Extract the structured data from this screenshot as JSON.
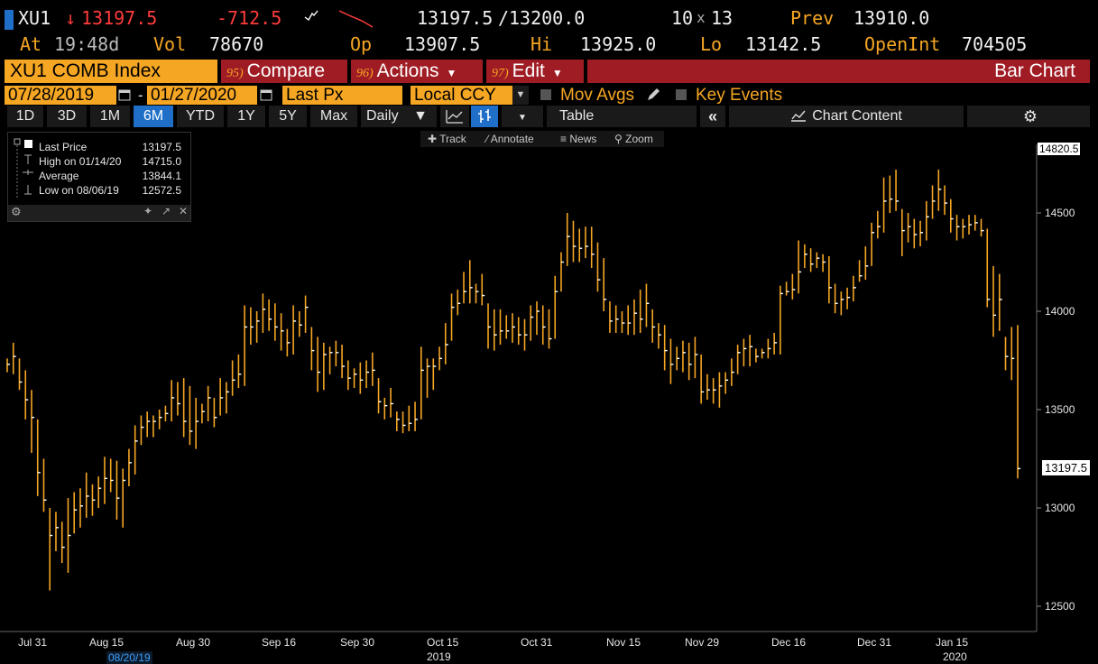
{
  "header": {
    "ticker": "XU1",
    "last": "13197.5",
    "change": "-712.5",
    "bid_ask": "13197.5",
    "ask": "13200.0",
    "size1": "10",
    "size2": "13",
    "prev_label": "Prev",
    "prev": "13910.0",
    "at_label": "At",
    "time": "19:48d",
    "vol_label": "Vol",
    "vol": "78670",
    "op_label": "Op",
    "op": "13907.5",
    "hi_label": "Hi",
    "hi": "13925.0",
    "lo_label": "Lo",
    "lo": "13142.5",
    "oi_label": "OpenInt",
    "oi": "704505"
  },
  "menu": {
    "security": "XU1 COMB Index",
    "compare_num": "95)",
    "compare": "Compare",
    "actions_num": "96)",
    "actions": "Actions",
    "edit_num": "97)",
    "edit": "Edit",
    "view": "Bar Chart"
  },
  "controls": {
    "start_date": "07/28/2019",
    "end_date": "01/27/2020",
    "field": "Last Px",
    "currency": "Local CCY",
    "mov_avgs": "Mov Avgs",
    "key_events": "Key Events"
  },
  "toolbar": {
    "periods": [
      "1D",
      "3D",
      "1M",
      "6M",
      "YTD",
      "1Y",
      "5Y",
      "Max"
    ],
    "selected_period": "6M",
    "frequency": "Daily",
    "table": "Table",
    "chart_content": "Chart Content"
  },
  "tools": {
    "track": "Track",
    "annotate": "Annotate",
    "news": "News",
    "zoom": "Zoom"
  },
  "legend": {
    "last_label": "Last Price",
    "last_value": "13197.5",
    "high_label": "High on 01/14/20",
    "high_value": "14715.0",
    "avg_label": "Average",
    "avg_value": "13844.1",
    "low_label": "Low on 08/06/19",
    "low_value": "12572.5"
  },
  "chart_data": {
    "type": "bar",
    "ylim": [
      12400,
      14900
    ],
    "y_ticks": [
      12500,
      13000,
      13500,
      14000,
      14500
    ],
    "y_tick_labels": [
      "12500",
      "13000",
      "13500",
      "14000",
      "14500"
    ],
    "top_marker": "14820.5",
    "last_marker": "13197.5",
    "x_tick_labels": [
      "Jul 31",
      "Aug 15",
      "Aug 30",
      "Sep 16",
      "Sep 30",
      "Oct 15",
      "Oct 31",
      "Nov 15",
      "Nov 29",
      "Dec 16",
      "Dec 31",
      "Jan 15"
    ],
    "x_sub_labels": [
      "08/20/19",
      "2019",
      "2020"
    ],
    "bars": [
      {
        "h": 13760,
        "l": 13690,
        "c": 13730
      },
      {
        "h": 13840,
        "l": 13680,
        "c": 13770
      },
      {
        "h": 13760,
        "l": 13600,
        "c": 13640
      },
      {
        "h": 13700,
        "l": 13450,
        "c": 13550
      },
      {
        "h": 13600,
        "l": 13280,
        "c": 13460
      },
      {
        "h": 13450,
        "l": 13060,
        "c": 13180
      },
      {
        "h": 13250,
        "l": 12980,
        "c": 13040
      },
      {
        "h": 13000,
        "l": 12580,
        "c": 12860
      },
      {
        "h": 12980,
        "l": 12780,
        "c": 12900
      },
      {
        "h": 12930,
        "l": 12720,
        "c": 12800
      },
      {
        "h": 13050,
        "l": 12670,
        "c": 12860
      },
      {
        "h": 13080,
        "l": 12870,
        "c": 12990
      },
      {
        "h": 13100,
        "l": 12900,
        "c": 13010
      },
      {
        "h": 13180,
        "l": 12950,
        "c": 13060
      },
      {
        "h": 13120,
        "l": 12960,
        "c": 13040
      },
      {
        "h": 13160,
        "l": 13000,
        "c": 13100
      },
      {
        "h": 13260,
        "l": 13020,
        "c": 13150
      },
      {
        "h": 13250,
        "l": 13080,
        "c": 13140
      },
      {
        "h": 13240,
        "l": 12940,
        "c": 13050
      },
      {
        "h": 13200,
        "l": 12900,
        "c": 13140
      },
      {
        "h": 13300,
        "l": 13110,
        "c": 13230
      },
      {
        "h": 13420,
        "l": 13170,
        "c": 13340
      },
      {
        "h": 13470,
        "l": 13320,
        "c": 13410
      },
      {
        "h": 13490,
        "l": 13360,
        "c": 13440
      },
      {
        "h": 13470,
        "l": 13360,
        "c": 13440
      },
      {
        "h": 13500,
        "l": 13400,
        "c": 13460
      },
      {
        "h": 13520,
        "l": 13440,
        "c": 13480
      },
      {
        "h": 13650,
        "l": 13440,
        "c": 13560
      },
      {
        "h": 13640,
        "l": 13470,
        "c": 13530
      },
      {
        "h": 13660,
        "l": 13360,
        "c": 13440
      },
      {
        "h": 13620,
        "l": 13320,
        "c": 13390
      },
      {
        "h": 13560,
        "l": 13300,
        "c": 13440
      },
      {
        "h": 13530,
        "l": 13430,
        "c": 13490
      },
      {
        "h": 13620,
        "l": 13440,
        "c": 13560
      },
      {
        "h": 13560,
        "l": 13410,
        "c": 13460
      },
      {
        "h": 13660,
        "l": 13470,
        "c": 13560
      },
      {
        "h": 13640,
        "l": 13480,
        "c": 13590
      },
      {
        "h": 13750,
        "l": 13570,
        "c": 13650
      },
      {
        "h": 13780,
        "l": 13610,
        "c": 13680
      },
      {
        "h": 14030,
        "l": 13620,
        "c": 13920
      },
      {
        "h": 14020,
        "l": 13830,
        "c": 13920
      },
      {
        "h": 14000,
        "l": 13840,
        "c": 13950
      },
      {
        "h": 14090,
        "l": 13890,
        "c": 14010
      },
      {
        "h": 14060,
        "l": 13900,
        "c": 13960
      },
      {
        "h": 14040,
        "l": 13850,
        "c": 13920
      },
      {
        "h": 13990,
        "l": 13800,
        "c": 13900
      },
      {
        "h": 13910,
        "l": 13770,
        "c": 13840
      },
      {
        "h": 14030,
        "l": 13780,
        "c": 13950
      },
      {
        "h": 14000,
        "l": 13870,
        "c": 13930
      },
      {
        "h": 14080,
        "l": 13890,
        "c": 14020
      },
      {
        "h": 13920,
        "l": 13700,
        "c": 13800
      },
      {
        "h": 13870,
        "l": 13590,
        "c": 13690
      },
      {
        "h": 13840,
        "l": 13600,
        "c": 13780
      },
      {
        "h": 13820,
        "l": 13680,
        "c": 13790
      },
      {
        "h": 13850,
        "l": 13720,
        "c": 13790
      },
      {
        "h": 13830,
        "l": 13660,
        "c": 13720
      },
      {
        "h": 13750,
        "l": 13600,
        "c": 13660
      },
      {
        "h": 13710,
        "l": 13610,
        "c": 13680
      },
      {
        "h": 13740,
        "l": 13580,
        "c": 13650
      },
      {
        "h": 13750,
        "l": 13610,
        "c": 13690
      },
      {
        "h": 13790,
        "l": 13620,
        "c": 13700
      },
      {
        "h": 13660,
        "l": 13480,
        "c": 13540
      },
      {
        "h": 13560,
        "l": 13450,
        "c": 13520
      },
      {
        "h": 13610,
        "l": 13460,
        "c": 13530
      },
      {
        "h": 13490,
        "l": 13390,
        "c": 13450
      },
      {
        "h": 13490,
        "l": 13380,
        "c": 13420
      },
      {
        "h": 13520,
        "l": 13390,
        "c": 13430
      },
      {
        "h": 13540,
        "l": 13390,
        "c": 13450
      },
      {
        "h": 13820,
        "l": 13450,
        "c": 13700
      },
      {
        "h": 13760,
        "l": 13560,
        "c": 13720
      },
      {
        "h": 13760,
        "l": 13600,
        "c": 13720
      },
      {
        "h": 13820,
        "l": 13700,
        "c": 13760
      },
      {
        "h": 13940,
        "l": 13730,
        "c": 13830
      },
      {
        "h": 14090,
        "l": 13850,
        "c": 14020
      },
      {
        "h": 14110,
        "l": 13980,
        "c": 14040
      },
      {
        "h": 14200,
        "l": 14040,
        "c": 14100
      },
      {
        "h": 14260,
        "l": 14040,
        "c": 14120
      },
      {
        "h": 14140,
        "l": 14040,
        "c": 14100
      },
      {
        "h": 14190,
        "l": 14030,
        "c": 14080
      },
      {
        "h": 14040,
        "l": 13810,
        "c": 13920
      },
      {
        "h": 14010,
        "l": 13800,
        "c": 13880
      },
      {
        "h": 14010,
        "l": 13830,
        "c": 13900
      },
      {
        "h": 13980,
        "l": 13860,
        "c": 13900
      },
      {
        "h": 13990,
        "l": 13840,
        "c": 13920
      },
      {
        "h": 13970,
        "l": 13830,
        "c": 13880
      },
      {
        "h": 13960,
        "l": 13800,
        "c": 13880
      },
      {
        "h": 14030,
        "l": 13850,
        "c": 13970
      },
      {
        "h": 14050,
        "l": 13880,
        "c": 14000
      },
      {
        "h": 14030,
        "l": 13830,
        "c": 13920
      },
      {
        "h": 14010,
        "l": 13810,
        "c": 13860
      },
      {
        "h": 14180,
        "l": 13860,
        "c": 14100
      },
      {
        "h": 14300,
        "l": 14100,
        "c": 14250
      },
      {
        "h": 14500,
        "l": 14230,
        "c": 14380
      },
      {
        "h": 14460,
        "l": 14250,
        "c": 14330
      },
      {
        "h": 14420,
        "l": 14250,
        "c": 14320
      },
      {
        "h": 14430,
        "l": 14270,
        "c": 14330
      },
      {
        "h": 14430,
        "l": 14220,
        "c": 14290
      },
      {
        "h": 14350,
        "l": 14100,
        "c": 14160
      },
      {
        "h": 14270,
        "l": 14000,
        "c": 14060
      },
      {
        "h": 14050,
        "l": 13890,
        "c": 13950
      },
      {
        "h": 14030,
        "l": 13890,
        "c": 13960
      },
      {
        "h": 14000,
        "l": 13890,
        "c": 13940
      },
      {
        "h": 14030,
        "l": 13880,
        "c": 13940
      },
      {
        "h": 14060,
        "l": 13880,
        "c": 13990
      },
      {
        "h": 14110,
        "l": 13890,
        "c": 13960
      },
      {
        "h": 14140,
        "l": 13920,
        "c": 14040
      },
      {
        "h": 14010,
        "l": 13840,
        "c": 13920
      },
      {
        "h": 13940,
        "l": 13810,
        "c": 13880
      },
      {
        "h": 13930,
        "l": 13700,
        "c": 13800
      },
      {
        "h": 13860,
        "l": 13630,
        "c": 13730
      },
      {
        "h": 13820,
        "l": 13700,
        "c": 13760
      },
      {
        "h": 13850,
        "l": 13690,
        "c": 13790
      },
      {
        "h": 13840,
        "l": 13650,
        "c": 13730
      },
      {
        "h": 13870,
        "l": 13660,
        "c": 13780
      },
      {
        "h": 13780,
        "l": 13530,
        "c": 13590
      },
      {
        "h": 13680,
        "l": 13550,
        "c": 13600
      },
      {
        "h": 13660,
        "l": 13530,
        "c": 13600
      },
      {
        "h": 13690,
        "l": 13510,
        "c": 13620
      },
      {
        "h": 13690,
        "l": 13580,
        "c": 13650
      },
      {
        "h": 13760,
        "l": 13620,
        "c": 13690
      },
      {
        "h": 13830,
        "l": 13680,
        "c": 13790
      },
      {
        "h": 13860,
        "l": 13720,
        "c": 13810
      },
      {
        "h": 13880,
        "l": 13720,
        "c": 13820
      },
      {
        "h": 13810,
        "l": 13740,
        "c": 13770
      },
      {
        "h": 13810,
        "l": 13760,
        "c": 13790
      },
      {
        "h": 13860,
        "l": 13760,
        "c": 13810
      },
      {
        "h": 13890,
        "l": 13780,
        "c": 13840
      },
      {
        "h": 14130,
        "l": 13780,
        "c": 14090
      },
      {
        "h": 14150,
        "l": 14080,
        "c": 14100
      },
      {
        "h": 14190,
        "l": 14060,
        "c": 14110
      },
      {
        "h": 14360,
        "l": 14090,
        "c": 14200
      },
      {
        "h": 14340,
        "l": 14220,
        "c": 14290
      },
      {
        "h": 14320,
        "l": 14200,
        "c": 14240
      },
      {
        "h": 14300,
        "l": 14220,
        "c": 14270
      },
      {
        "h": 14290,
        "l": 14200,
        "c": 14250
      },
      {
        "h": 14280,
        "l": 14040,
        "c": 14120
      },
      {
        "h": 14140,
        "l": 13990,
        "c": 14040
      },
      {
        "h": 14100,
        "l": 13980,
        "c": 14060
      },
      {
        "h": 14120,
        "l": 14010,
        "c": 14070
      },
      {
        "h": 14180,
        "l": 14050,
        "c": 14120
      },
      {
        "h": 14260,
        "l": 14150,
        "c": 14180
      },
      {
        "h": 14330,
        "l": 14160,
        "c": 14230
      },
      {
        "h": 14450,
        "l": 14230,
        "c": 14400
      },
      {
        "h": 14510,
        "l": 14370,
        "c": 14430
      },
      {
        "h": 14680,
        "l": 14400,
        "c": 14560
      },
      {
        "h": 14690,
        "l": 14500,
        "c": 14570
      },
      {
        "h": 14720,
        "l": 14510,
        "c": 14560
      },
      {
        "h": 14520,
        "l": 14280,
        "c": 14410
      },
      {
        "h": 14500,
        "l": 14350,
        "c": 14430
      },
      {
        "h": 14470,
        "l": 14320,
        "c": 14390
      },
      {
        "h": 14460,
        "l": 14330,
        "c": 14400
      },
      {
        "h": 14560,
        "l": 14360,
        "c": 14480
      },
      {
        "h": 14640,
        "l": 14470,
        "c": 14560
      },
      {
        "h": 14720,
        "l": 14510,
        "c": 14620
      },
      {
        "h": 14640,
        "l": 14490,
        "c": 14550
      },
      {
        "h": 14570,
        "l": 14400,
        "c": 14470
      },
      {
        "h": 14490,
        "l": 14360,
        "c": 14430
      },
      {
        "h": 14470,
        "l": 14370,
        "c": 14430
      },
      {
        "h": 14490,
        "l": 14390,
        "c": 14440
      },
      {
        "h": 14490,
        "l": 14410,
        "c": 14450
      },
      {
        "h": 14470,
        "l": 14380,
        "c": 14410
      },
      {
        "h": 14420,
        "l": 14020,
        "c": 14060
      },
      {
        "h": 14230,
        "l": 13870,
        "c": 13980
      },
      {
        "h": 14190,
        "l": 13900,
        "c": 14060
      },
      {
        "h": 13870,
        "l": 13700,
        "c": 13770
      },
      {
        "h": 13920,
        "l": 13650,
        "c": 13760
      },
      {
        "h": 13930,
        "l": 13150,
        "c": 13200
      }
    ]
  }
}
